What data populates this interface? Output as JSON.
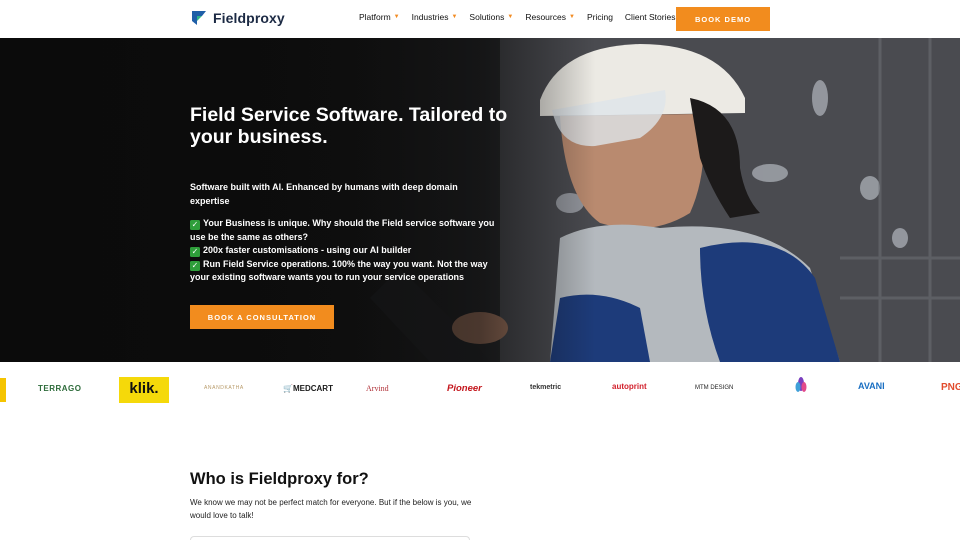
{
  "header": {
    "brand": "Fieldproxy",
    "nav": [
      {
        "label": "Platform",
        "has_dropdown": true
      },
      {
        "label": "Industries",
        "has_dropdown": true
      },
      {
        "label": "Solutions",
        "has_dropdown": true
      },
      {
        "label": "Resources",
        "has_dropdown": true
      },
      {
        "label": "Pricing",
        "has_dropdown": false
      },
      {
        "label": "Client Stories",
        "has_dropdown": false
      }
    ],
    "cta": "BOOK DEMO"
  },
  "hero": {
    "title": "Field Service Software. Tailored to your business.",
    "subtitle": "Software built with AI. Enhanced by humans with deep domain expertise",
    "points": [
      "Your Business is unique. Why should the Field service software you use be the same as others?",
      "200x faster customisations - using our AI builder",
      "Run Field Service operations. 100% the way you want. Not the way your existing software wants you to run your service operations"
    ],
    "cta": "BOOK A CONSULTATION"
  },
  "client_logos": [
    "TERRAGO",
    "klik.",
    "ANANDKATHA",
    "MEDCART",
    "Arvind",
    "Pioneer",
    "tekmetric",
    "autoprint",
    "MTM DESIGN",
    "AVANI",
    "PNG"
  ],
  "who": {
    "title": "Who is Fieldproxy for?",
    "text": "We know we may not be perfect match for everyone. But if the below is you, we would love to talk!"
  },
  "colors": {
    "accent": "#f28c1e",
    "brand_dark": "#1c2a44",
    "check_green": "#2e9e3a"
  }
}
